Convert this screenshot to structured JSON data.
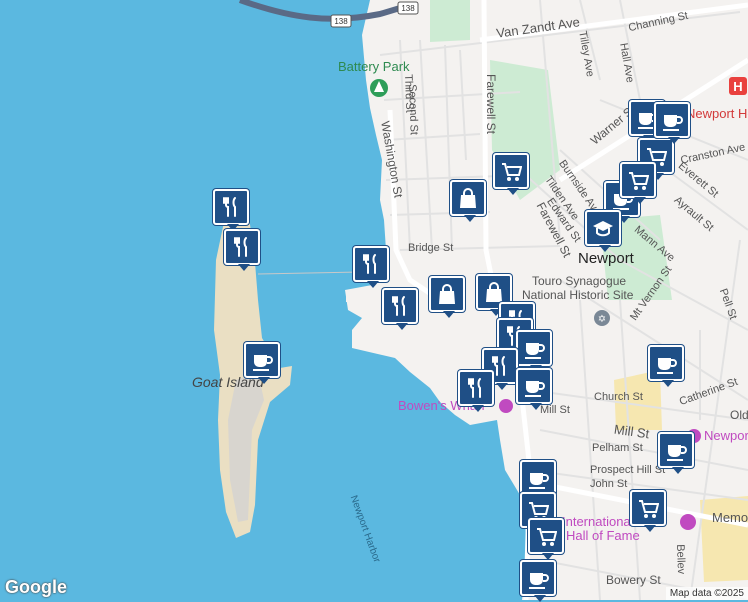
{
  "map": {
    "colors": {
      "water": "#5bb8e0",
      "land": "#f4f2f0",
      "island_sand": "#eadfc3",
      "park": "#cdebd3",
      "road": "#ffffff",
      "minor_road": "#e2e2e2",
      "marker": "#1f4f86",
      "hospital": "#e9413e",
      "highlight": "#c04ac0"
    },
    "shields": [
      "138",
      "138"
    ],
    "labels": {
      "van_zandt": "Van Zandt Ave",
      "channing": "Channing St",
      "battery_park": "Battery Park",
      "third_st": "Third St",
      "second_st": "Second St",
      "farewell_1": "Farewell St",
      "farewell_2": "Farewell St",
      "washington": "Washington St",
      "tilley": "Tilley Ave",
      "hall": "Hall Ave",
      "warner": "Warner St",
      "hospital": "Newport Hospital",
      "cranston": "Cranston Ave",
      "everett": "Everett St",
      "burnside": "Burnside Ave",
      "tilden": "Tilden Ave",
      "edward": "Edward St",
      "ayrault": "Ayrault St",
      "mann": "Mann Ave",
      "bridge": "Bridge St",
      "newport": "Newport",
      "touro_1": "Touro Synagogue",
      "touro_2": "National Historic Site",
      "goat_island": "Goat Island",
      "mt_vernon": "Mt Vernon St",
      "pell": "Pell St",
      "catherine": "Catherine St",
      "church": "Church St",
      "bowens": "Bowen's Wharf",
      "mill_1": "Mill St",
      "mill_2": "Mill St",
      "newport_right": "Newport",
      "pelham": "Pelham St",
      "prospect": "Prospect Hill St",
      "john": "John St",
      "international_1": "International",
      "international_2": "Hall of Fame",
      "memorial": "Memo",
      "newport_harbor": "Newport Harbor",
      "bowery": "Bowery St",
      "bellevue": "Bellev",
      "old": "Old"
    },
    "attribution": "Map data ©2025",
    "logo": "Google",
    "markers": [
      {
        "icon": "restaurant"
      },
      {
        "icon": "restaurant"
      },
      {
        "icon": "restaurant"
      },
      {
        "icon": "restaurant"
      },
      {
        "icon": "cafe"
      },
      {
        "icon": "cafe"
      },
      {
        "icon": "shopping-cart"
      },
      {
        "icon": "shopping-cart"
      },
      {
        "icon": "cafe"
      },
      {
        "icon": "shopping-bag"
      },
      {
        "icon": "cafe"
      },
      {
        "icon": "school"
      },
      {
        "icon": "shopping-bag"
      },
      {
        "icon": "shopping-bag"
      },
      {
        "icon": "restaurant"
      },
      {
        "icon": "restaurant"
      },
      {
        "icon": "cafe"
      },
      {
        "icon": "restaurant"
      },
      {
        "icon": "cafe"
      },
      {
        "icon": "restaurant"
      },
      {
        "icon": "cafe"
      },
      {
        "icon": "cafe"
      },
      {
        "icon": "cafe"
      },
      {
        "icon": "shopping-cart"
      },
      {
        "icon": "shopping-cart"
      },
      {
        "icon": "shopping-cart"
      },
      {
        "icon": "cafe"
      },
      {
        "icon": "shopping-cart"
      }
    ]
  }
}
